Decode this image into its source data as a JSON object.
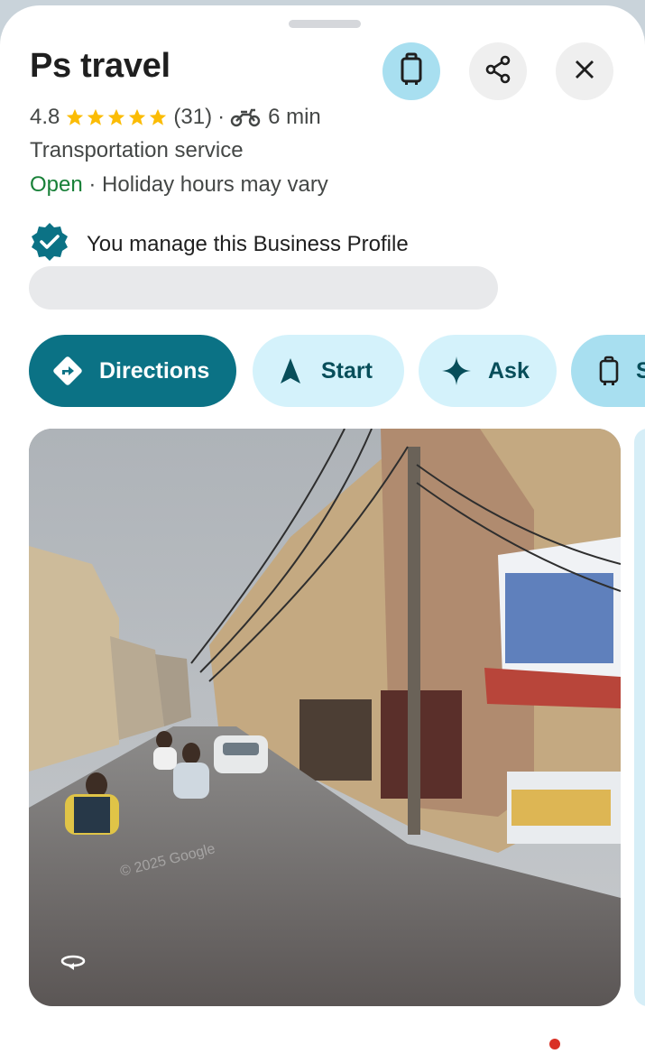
{
  "place": {
    "name": "Ps travel",
    "rating": "4.8",
    "review_count": "(31)",
    "travel_time": "6 min",
    "category": "Transportation service",
    "status": "Open",
    "hours_note": "· Holiday hours may vary",
    "manage_text": "You manage this Business Profile"
  },
  "header_buttons": {
    "lodging_icon": "luggage-icon",
    "share_icon": "share-icon",
    "close_icon": "close-icon"
  },
  "actions": [
    {
      "label": "Directions",
      "icon": "directions-icon"
    },
    {
      "label": "Start",
      "icon": "navigation-arrow-icon"
    },
    {
      "label": "Ask",
      "icon": "sparkle-icon"
    },
    {
      "label": "S",
      "icon": "luggage-icon"
    }
  ],
  "photo": {
    "watermark": "© 2025 Google"
  },
  "colors": {
    "accent": "#0b7285",
    "chip_bg": "#d4f2fb",
    "open": "#188038",
    "star": "#fbbc04"
  }
}
